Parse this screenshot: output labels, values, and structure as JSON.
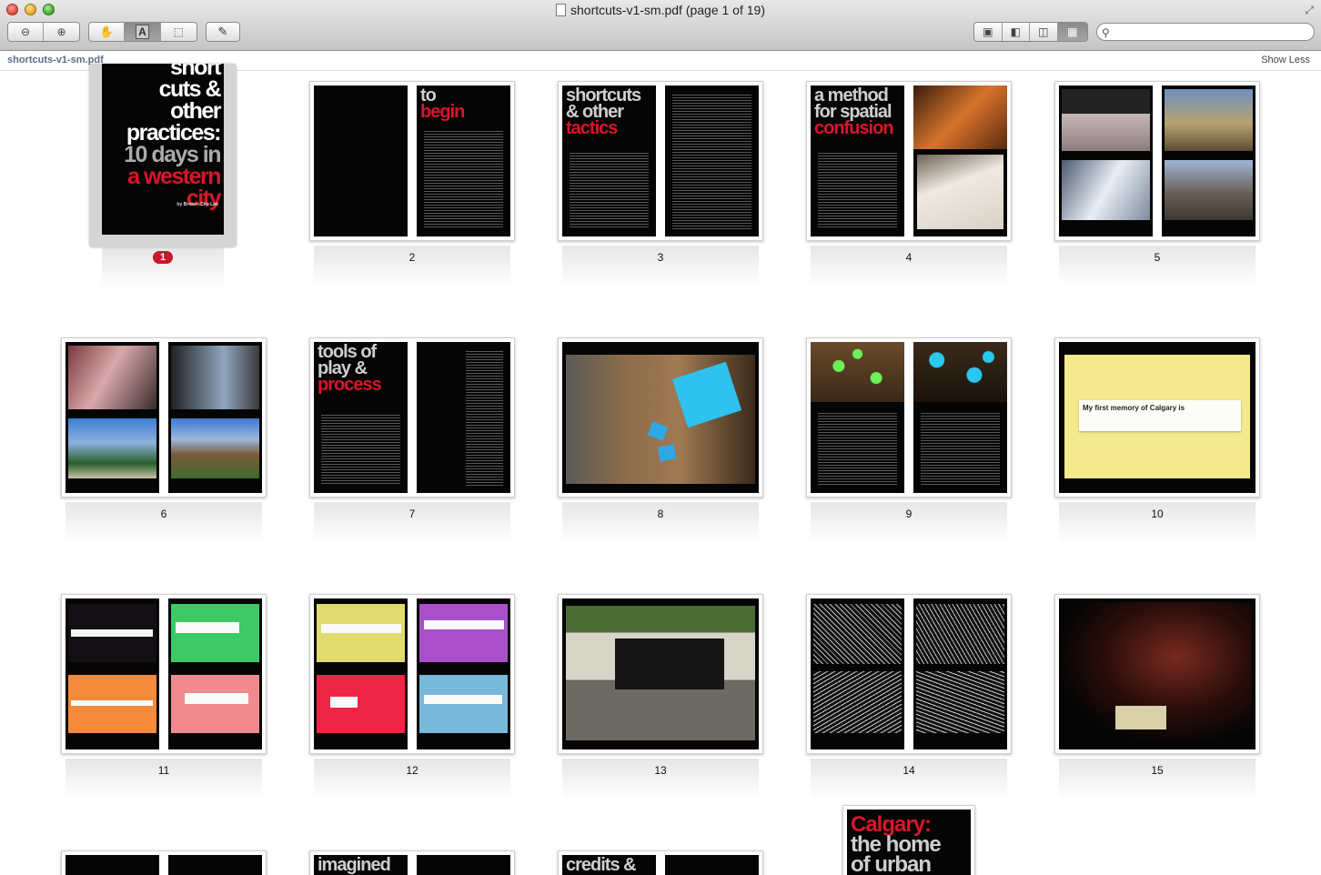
{
  "window": {
    "title": "shortcuts-v1-sm.pdf (page 1 of 19)"
  },
  "toolbar": {
    "zoom_out_icon": "zoom-out-icon",
    "zoom_in_icon": "zoom-in-icon",
    "tools": [
      "hand-icon",
      "text-select-icon",
      "rect-select-icon"
    ],
    "annotate_icon": "pencil-icon",
    "views": [
      "single-page-icon",
      "sidebar-icon",
      "two-page-icon",
      "contact-sheet-icon"
    ],
    "search_placeholder": ""
  },
  "subbar": {
    "filename": "shortcuts-v1-sm.pdf",
    "show_less": "Show Less"
  },
  "cover": {
    "lines": [
      "short",
      "cuts &",
      "other",
      "practices:",
      "10 days in",
      "a western",
      "city"
    ],
    "byline": "by Broken City Lab",
    "selected_badge": "1"
  },
  "pages": [
    {
      "num": "2",
      "left_head": "",
      "right_head_red": "begin",
      "right_head": "to"
    },
    {
      "num": "3",
      "left_head": "shortcuts & other",
      "left_head_red": "tactics"
    },
    {
      "num": "4",
      "left_head": "a method for spatial",
      "left_head_red": "confusion"
    },
    {
      "num": "5"
    },
    {
      "num": "6"
    },
    {
      "num": "7",
      "left_head": "tools of play &",
      "left_head_red": "process"
    },
    {
      "num": "8"
    },
    {
      "num": "9"
    },
    {
      "num": "10",
      "caption": "My first memory of Calgary is"
    },
    {
      "num": "11"
    },
    {
      "num": "12"
    },
    {
      "num": "13"
    },
    {
      "num": "14"
    },
    {
      "num": "15"
    }
  ],
  "bottom_row": {
    "p2_head": "imagined",
    "p3_head": "credits &",
    "single_lines": [
      "Calgary:",
      "the home",
      "of urban"
    ]
  }
}
